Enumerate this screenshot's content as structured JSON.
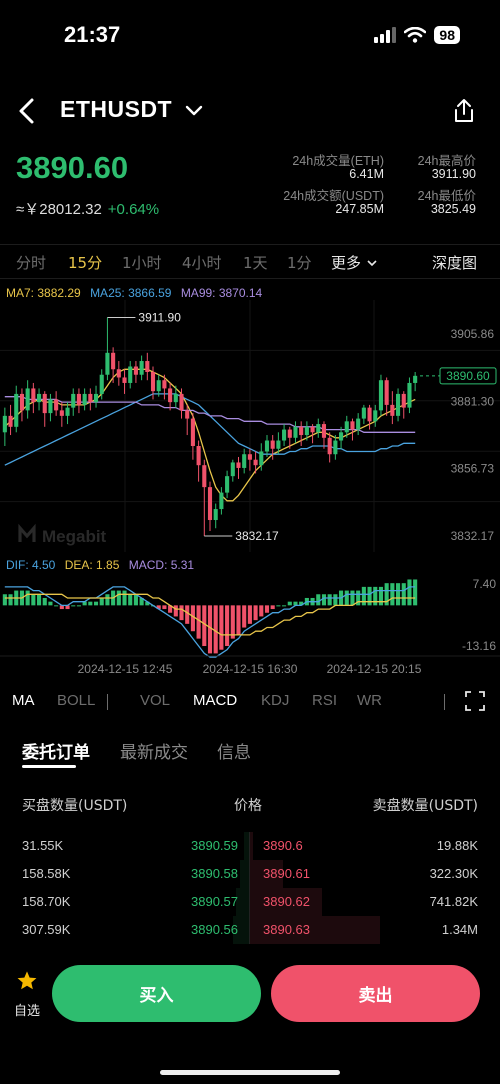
{
  "status": {
    "time": "21:37",
    "battery": "98"
  },
  "header": {
    "symbol": "ETHUSDT"
  },
  "ticker": {
    "last_price": "3890.60",
    "cny_price": "≈￥28012.32",
    "change_pct": "+0.64%",
    "stats": [
      {
        "label": "24h成交量(ETH)",
        "value": "6.41M"
      },
      {
        "label": "24h最高价",
        "value": "3911.90"
      },
      {
        "label": "24h成交额(USDT)",
        "value": "247.85M"
      },
      {
        "label": "24h最低价",
        "value": "3825.49"
      }
    ]
  },
  "timeframes": [
    {
      "label": "分时"
    },
    {
      "label": "15分"
    },
    {
      "label": "1小时"
    },
    {
      "label": "4小时"
    },
    {
      "label": "1天"
    },
    {
      "label": "1分"
    },
    {
      "label": "更多"
    },
    {
      "label": "深度图"
    }
  ],
  "ma_legend": [
    {
      "text": "MA7: 3882.29",
      "color": "#e8c54a"
    },
    {
      "text": "MA25: 3866.59",
      "color": "#4aa3df"
    },
    {
      "text": "MA99: 3870.14",
      "color": "#a98de0"
    }
  ],
  "macd_legend": [
    {
      "text": "DIF: 4.50",
      "color": "#4aa3df"
    },
    {
      "text": "DEA: 1.85",
      "color": "#e8c54a"
    },
    {
      "text": "MACD: 5.31",
      "color": "#a98de0"
    }
  ],
  "chart_data": {
    "type": "candlestick",
    "price_axis_ticks": [
      "3905.86",
      "3881.30",
      "3856.73",
      "3832.17"
    ],
    "current_price_label": "3890.60",
    "high_annotation": "3911.90",
    "low_annotation": "3832.17",
    "ylim": [
      3832.17,
      3905.86
    ],
    "macd_axis_ticks": [
      "7.40",
      "-13.16"
    ],
    "time_axis_labels": [
      "2024-12-15 12:45",
      "2024-12-15 16:30",
      "2024-12-15 20:15"
    ],
    "watermark": "Megabit",
    "candles": [
      [
        3870,
        3876,
        3865,
        3879
      ],
      [
        3876,
        3872,
        3869,
        3880
      ],
      [
        3872,
        3884,
        3870,
        3887
      ],
      [
        3884,
        3878,
        3874,
        3886
      ],
      [
        3878,
        3886,
        3875,
        3889
      ],
      [
        3886,
        3881,
        3877,
        3888
      ],
      [
        3881,
        3884,
        3878,
        3886
      ],
      [
        3884,
        3877,
        3872,
        3885
      ],
      [
        3877,
        3882,
        3874,
        3884
      ],
      [
        3882,
        3878,
        3876,
        3885
      ],
      [
        3878,
        3876,
        3872,
        3881
      ],
      [
        3876,
        3879,
        3873,
        3881
      ],
      [
        3879,
        3884,
        3876,
        3886
      ],
      [
        3884,
        3880,
        3877,
        3886
      ],
      [
        3880,
        3884,
        3878,
        3886
      ],
      [
        3884,
        3881,
        3878,
        3886
      ],
      [
        3881,
        3884,
        3879,
        3887
      ],
      [
        3884,
        3891,
        3882,
        3893
      ],
      [
        3891,
        3899,
        3889,
        3911.9
      ],
      [
        3899,
        3893,
        3888,
        3901
      ],
      [
        3893,
        3890,
        3887,
        3896
      ],
      [
        3890,
        3888,
        3884,
        3893
      ],
      [
        3888,
        3894,
        3886,
        3896
      ],
      [
        3894,
        3891,
        3888,
        3896
      ],
      [
        3891,
        3896,
        3889,
        3898
      ],
      [
        3896,
        3892,
        3889,
        3899
      ],
      [
        3892,
        3885,
        3882,
        3894
      ],
      [
        3885,
        3889,
        3883,
        3891
      ],
      [
        3889,
        3886,
        3882,
        3891
      ],
      [
        3886,
        3881,
        3878,
        3888
      ],
      [
        3881,
        3884,
        3879,
        3887
      ],
      [
        3884,
        3878,
        3875,
        3886
      ],
      [
        3878,
        3875,
        3869,
        3880
      ],
      [
        3875,
        3865,
        3860,
        3877
      ],
      [
        3865,
        3858,
        3852,
        3867
      ],
      [
        3858,
        3850,
        3832.17,
        3860
      ],
      [
        3850,
        3838,
        3834,
        3852
      ],
      [
        3838,
        3842,
        3835,
        3844
      ],
      [
        3842,
        3848,
        3840,
        3850
      ],
      [
        3848,
        3854,
        3846,
        3856
      ],
      [
        3854,
        3859,
        3852,
        3860
      ],
      [
        3859,
        3857,
        3853,
        3861
      ],
      [
        3857,
        3862,
        3855,
        3864
      ],
      [
        3862,
        3860,
        3856,
        3864
      ],
      [
        3860,
        3858,
        3855,
        3863
      ],
      [
        3858,
        3863,
        3856,
        3866
      ],
      [
        3863,
        3867,
        3861,
        3869
      ],
      [
        3867,
        3864,
        3860,
        3869
      ],
      [
        3864,
        3867,
        3862,
        3870
      ],
      [
        3867,
        3871,
        3865,
        3873
      ],
      [
        3871,
        3868,
        3864,
        3872
      ],
      [
        3868,
        3872,
        3866,
        3874
      ],
      [
        3872,
        3869,
        3865,
        3874
      ],
      [
        3869,
        3872,
        3867,
        3874
      ],
      [
        3872,
        3870,
        3866,
        3873
      ],
      [
        3870,
        3873,
        3868,
        3875
      ],
      [
        3873,
        3868,
        3864,
        3874
      ],
      [
        3868,
        3862,
        3859,
        3870
      ],
      [
        3862,
        3867,
        3860,
        3869
      ],
      [
        3867,
        3870,
        3864,
        3872
      ],
      [
        3870,
        3874,
        3868,
        3876
      ],
      [
        3874,
        3871,
        3867,
        3875
      ],
      [
        3871,
        3875,
        3869,
        3877
      ],
      [
        3875,
        3879,
        3873,
        3880
      ],
      [
        3879,
        3874,
        3871,
        3880
      ],
      [
        3874,
        3878,
        3872,
        3880
      ],
      [
        3878,
        3889,
        3876,
        3891
      ],
      [
        3889,
        3880,
        3876,
        3890
      ],
      [
        3880,
        3876,
        3873,
        3885
      ],
      [
        3876,
        3884,
        3874,
        3886
      ],
      [
        3884,
        3879,
        3875,
        3885
      ],
      [
        3879,
        3888,
        3877,
        3890
      ],
      [
        3888,
        3890.6,
        3885,
        3892
      ]
    ],
    "series": [
      {
        "name": "MA7",
        "color": "#e8c54a",
        "values": [
          3872,
          3874,
          3876,
          3878,
          3880,
          3881,
          3882,
          3881,
          3881,
          3881,
          3880,
          3880,
          3880,
          3880,
          3880,
          3881,
          3882,
          3884,
          3887,
          3890,
          3892,
          3893,
          3893,
          3893,
          3893,
          3893,
          3892,
          3891,
          3890,
          3888,
          3886,
          3884,
          3880,
          3876,
          3870,
          3863,
          3856,
          3850,
          3847,
          3845,
          3845,
          3847,
          3850,
          3853,
          3856,
          3858,
          3860,
          3862,
          3863,
          3864,
          3865,
          3866,
          3867,
          3868,
          3869,
          3870,
          3870,
          3869,
          3868,
          3868,
          3869,
          3870,
          3871,
          3872,
          3873,
          3874,
          3876,
          3877,
          3878,
          3879,
          3880,
          3881,
          3882
        ]
      },
      {
        "name": "MA25",
        "color": "#4aa3df",
        "values": [
          3858,
          3859,
          3860,
          3861,
          3862,
          3863,
          3864,
          3865,
          3866,
          3867,
          3868,
          3869,
          3870,
          3871,
          3872,
          3873,
          3874,
          3875,
          3876,
          3877,
          3878,
          3879,
          3880,
          3881,
          3882,
          3883,
          3884,
          3884,
          3884,
          3884,
          3884,
          3883,
          3882,
          3881,
          3880,
          3878,
          3876,
          3874,
          3872,
          3870,
          3868,
          3866,
          3865,
          3864,
          3863,
          3862,
          3862,
          3862,
          3862,
          3862,
          3863,
          3863,
          3864,
          3864,
          3865,
          3865,
          3865,
          3865,
          3864,
          3864,
          3863,
          3863,
          3863,
          3863,
          3863,
          3863,
          3864,
          3864,
          3865,
          3865,
          3866,
          3866,
          3866
        ]
      },
      {
        "name": "MA99",
        "color": "#a98de0",
        "values": [
          3883,
          3883,
          3883,
          3883,
          3882,
          3882,
          3882,
          3882,
          3882,
          3882,
          3881,
          3881,
          3881,
          3881,
          3881,
          3881,
          3881,
          3881,
          3881,
          3881,
          3881,
          3881,
          3881,
          3881,
          3880,
          3880,
          3880,
          3880,
          3879,
          3879,
          3879,
          3878,
          3878,
          3878,
          3877,
          3877,
          3876,
          3876,
          3876,
          3875,
          3875,
          3875,
          3874,
          3874,
          3874,
          3874,
          3873,
          3873,
          3873,
          3873,
          3873,
          3872,
          3872,
          3872,
          3872,
          3872,
          3871,
          3871,
          3871,
          3871,
          3871,
          3871,
          3871,
          3870,
          3870,
          3870,
          3870,
          3870,
          3870,
          3870,
          3870,
          3870,
          3870
        ]
      }
    ],
    "macd_hist": [
      3,
      3,
      4,
      4,
      4,
      3,
      3,
      2,
      1,
      0,
      -1,
      -1,
      0,
      0,
      1,
      1,
      1,
      2,
      3,
      4,
      4,
      4,
      3,
      3,
      2,
      1,
      0,
      -1,
      -1,
      -2,
      -3,
      -4,
      -5,
      -7,
      -9,
      -11,
      -13,
      -13,
      -12,
      -11,
      -9,
      -8,
      -6,
      -5,
      -4,
      -3,
      -2,
      -1,
      0,
      0,
      1,
      1,
      1,
      2,
      2,
      3,
      3,
      3,
      3,
      4,
      4,
      4,
      4,
      5,
      5,
      5,
      5,
      6,
      6,
      6,
      6,
      7,
      7
    ],
    "dif": [
      5,
      5,
      5,
      5,
      5,
      4,
      4,
      3,
      2,
      1,
      0,
      0,
      1,
      1,
      1,
      2,
      2,
      3,
      4,
      5,
      5,
      5,
      4,
      3,
      2,
      1,
      0,
      -1,
      -2,
      -3,
      -4,
      -5,
      -7,
      -9,
      -11,
      -13,
      -14,
      -14,
      -13,
      -12,
      -10,
      -9,
      -7,
      -6,
      -5,
      -4,
      -3,
      -2,
      -2,
      -1,
      -1,
      0,
      0,
      1,
      1,
      1,
      2,
      2,
      2,
      2,
      3,
      3,
      3,
      3,
      3,
      4,
      4,
      4,
      4,
      4,
      4,
      5,
      5
    ],
    "dea": [
      2,
      2,
      2,
      2,
      3,
      3,
      3,
      3,
      3,
      3,
      3,
      2,
      2,
      2,
      2,
      2,
      2,
      2,
      2,
      2,
      3,
      3,
      3,
      3,
      3,
      3,
      2,
      2,
      1,
      0,
      -1,
      -1,
      -2,
      -3,
      -4,
      -5,
      -6,
      -7,
      -8,
      -8,
      -8,
      -8,
      -8,
      -8,
      -7,
      -7,
      -6,
      -6,
      -5,
      -4,
      -4,
      -3,
      -3,
      -2,
      -2,
      -1,
      -1,
      -1,
      0,
      0,
      0,
      0,
      1,
      1,
      1,
      1,
      1,
      1,
      2,
      2,
      2,
      2,
      2
    ]
  },
  "indicator_tabs": [
    {
      "label": "MA"
    },
    {
      "label": "BOLL"
    },
    {
      "label": "VOL"
    },
    {
      "label": "MACD"
    },
    {
      "label": "KDJ"
    },
    {
      "label": "RSI"
    },
    {
      "label": "WR"
    }
  ],
  "main_tabs": [
    {
      "label": "委托订单"
    },
    {
      "label": "最新成交"
    },
    {
      "label": "信息"
    }
  ],
  "orderbook": {
    "hdr_bid": "买盘数量(USDT)",
    "hdr_price": "价格",
    "hdr_ask": "卖盘数量(USDT)",
    "rows": [
      {
        "bid_qty": "31.55K",
        "bid_px": "3890.59",
        "ask_px": "3890.6",
        "ask_qty": "19.88K",
        "bid_depth": 0.03,
        "ask_depth": 0.02
      },
      {
        "bid_qty": "158.58K",
        "bid_px": "3890.58",
        "ask_px": "3890.61",
        "ask_qty": "322.30K",
        "bid_depth": 0.05,
        "ask_depth": 0.25
      },
      {
        "bid_qty": "158.70K",
        "bid_px": "3890.57",
        "ask_px": "3890.62",
        "ask_qty": "741.82K",
        "bid_depth": 0.07,
        "ask_depth": 0.55
      },
      {
        "bid_qty": "307.59K",
        "bid_px": "3890.56",
        "ask_px": "3890.63",
        "ask_qty": "1.34M",
        "bid_depth": 0.09,
        "ask_depth": 1.0
      }
    ]
  },
  "bottom": {
    "favorite_label": "自选",
    "buy_label": "买入",
    "sell_label": "卖出"
  }
}
